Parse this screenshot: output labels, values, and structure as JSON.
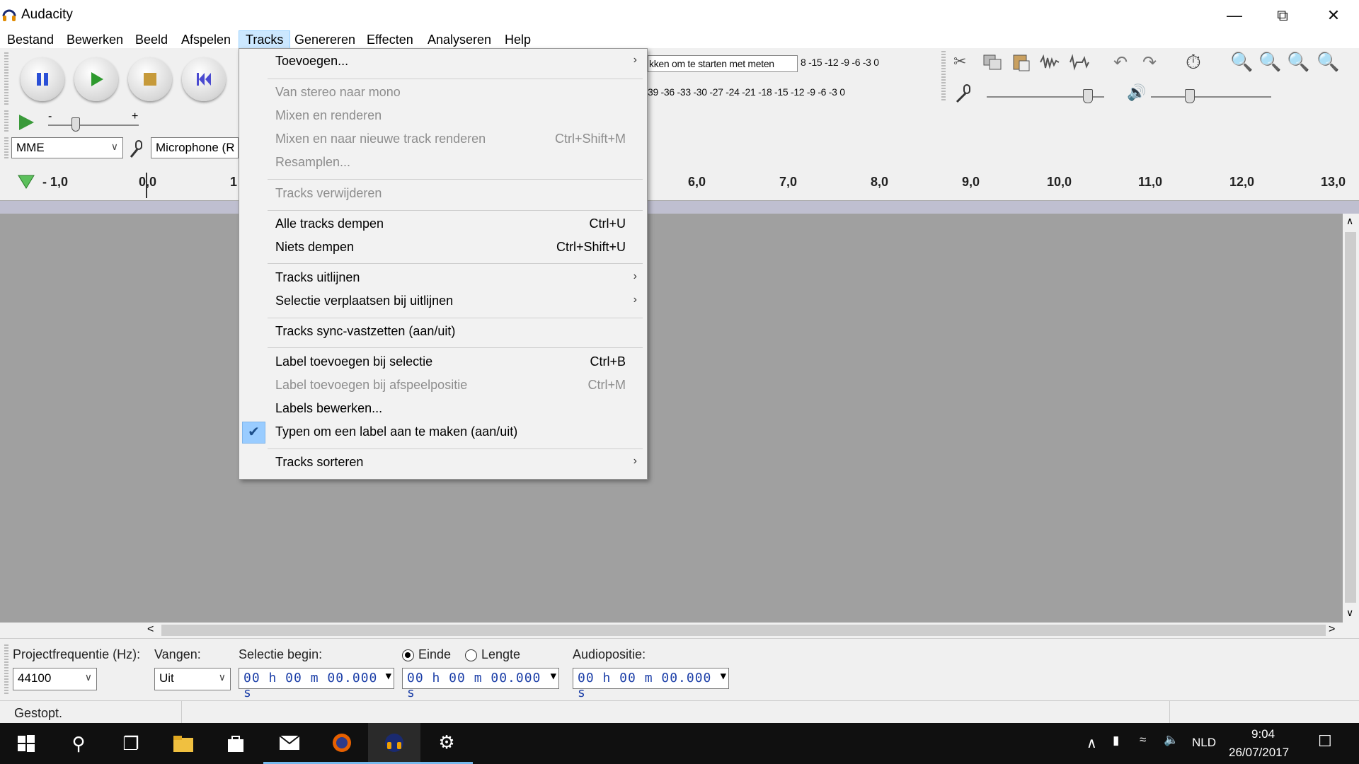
{
  "window": {
    "title": "Audacity"
  },
  "menubar": {
    "items": [
      "Bestand",
      "Bewerken",
      "Beeld",
      "Afspelen",
      "Tracks",
      "Genereren",
      "Effecten",
      "Analyseren",
      "Help"
    ],
    "active": "Tracks"
  },
  "toolbar": {
    "meter_record_text": "kken om te starten met meten",
    "meter_record_scale": "8 -15 -12  -9  -6  -3  0",
    "meter_play_scale": "39 -36 -33 -30 -27 -24 -21 -18 -15 -12  -9  -6  -3  0",
    "host": "MME",
    "input_device": "Microphone (R",
    "slider_minus": "-",
    "slider_plus": "+"
  },
  "ruler": {
    "labels": [
      "- 1,0",
      "0,0",
      "1",
      "6,0",
      "7,0",
      "8,0",
      "9,0",
      "10,0",
      "11,0",
      "12,0",
      "13,0"
    ]
  },
  "tracks_menu": {
    "items": [
      {
        "label": "Toevoegen...",
        "shortcut": "",
        "submenu": true,
        "disabled": false
      },
      {
        "label": "Van stereo naar mono",
        "shortcut": "",
        "disabled": true
      },
      {
        "label": "Mixen en renderen",
        "shortcut": "",
        "disabled": true
      },
      {
        "label": "Mixen en naar nieuwe track renderen",
        "shortcut": "Ctrl+Shift+M",
        "disabled": true
      },
      {
        "label": "Resamplen...",
        "shortcut": "",
        "disabled": true
      },
      {
        "label": "Tracks verwijderen",
        "shortcut": "",
        "disabled": true
      },
      {
        "label": "Alle tracks dempen",
        "shortcut": "Ctrl+U",
        "disabled": false
      },
      {
        "label": "Niets dempen",
        "shortcut": "Ctrl+Shift+U",
        "disabled": false
      },
      {
        "label": "Tracks uitlijnen",
        "shortcut": "",
        "submenu": true,
        "disabled": false
      },
      {
        "label": "Selectie verplaatsen bij uitlijnen",
        "shortcut": "",
        "submenu": true,
        "disabled": false
      },
      {
        "label": "Tracks sync-vastzetten (aan/uit)",
        "shortcut": "",
        "disabled": false
      },
      {
        "label": "Label toevoegen bij selectie",
        "shortcut": "Ctrl+B",
        "disabled": false
      },
      {
        "label": "Label toevoegen bij afspeelpositie",
        "shortcut": "Ctrl+M",
        "disabled": true
      },
      {
        "label": "Labels bewerken...",
        "shortcut": "",
        "disabled": false
      },
      {
        "label": "Typen om een label aan te maken (aan/uit)",
        "shortcut": "",
        "checked": true,
        "disabled": false
      },
      {
        "label": "Tracks sorteren",
        "shortcut": "",
        "submenu": true,
        "disabled": false
      }
    ]
  },
  "selection_toolbar": {
    "project_rate_label": "Projectfrequentie (Hz):",
    "project_rate": "44100",
    "snap_label": "Vangen:",
    "snap_value": "Uit",
    "sel_begin_label": "Selectie begin:",
    "end_label": "Einde",
    "length_label": "Lengte",
    "audio_pos_label": "Audiopositie:",
    "sel_begin": "00 h 00 m 00.000 s",
    "sel_end": "00 h 00 m 00.000 s",
    "audio_pos": "00 h 00 m 00.000 s"
  },
  "status": {
    "text": "Gestopt."
  },
  "taskbar": {
    "language": "NLD",
    "time": "9:04",
    "date": "26/07/2017"
  },
  "colors": {
    "accent": "#99ccff",
    "track_bg": "#a0a0a0",
    "time_digits": "#1c3fa8"
  }
}
